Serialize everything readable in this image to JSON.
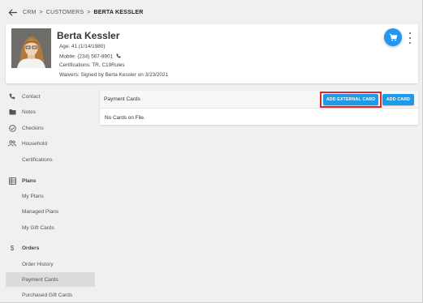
{
  "breadcrumb": {
    "items": [
      "CRM",
      "CUSTOMERS",
      "BERTA KESSLER"
    ],
    "separator": ">"
  },
  "profile": {
    "name": "Berta Kessler",
    "age": "Age: 41 (1/14/1980)",
    "mobile": "Mobile: (234) 567-8901",
    "certifications": "Certifications: TR, C19Rules",
    "waivers": "Waivers: Signed by Berta Kessler on 3/23/2021"
  },
  "sidebar": {
    "items": [
      {
        "label": "Contact",
        "icon": "phone-icon"
      },
      {
        "label": "Notes",
        "icon": "folder-icon"
      },
      {
        "label": "Checkins",
        "icon": "check-circle-icon"
      },
      {
        "label": "Household",
        "icon": "people-icon"
      },
      {
        "label": "Certifications",
        "icon": ""
      },
      {
        "label": "Plans",
        "icon": "grid-icon"
      },
      {
        "label": "My Plans",
        "icon": ""
      },
      {
        "label": "Managed Plans",
        "icon": ""
      },
      {
        "label": "My Gift Cards",
        "icon": ""
      },
      {
        "label": "Orders",
        "icon": "dollar-icon"
      },
      {
        "label": "Order History",
        "icon": ""
      },
      {
        "label": "Payment Cards",
        "icon": ""
      },
      {
        "label": "Purchased Gift Cards",
        "icon": ""
      }
    ],
    "active": "Payment Cards"
  },
  "payment_cards": {
    "title": "Payment Cards",
    "add_external_label": "ADD EXTERNAL CARD",
    "add_card_label": "ADD CARD",
    "empty_message": "No Cards on File."
  },
  "colors": {
    "accent": "#2196f3",
    "button": "#1e9be8",
    "highlight": "#e3242b",
    "active_nav": "#dcdcdc"
  }
}
